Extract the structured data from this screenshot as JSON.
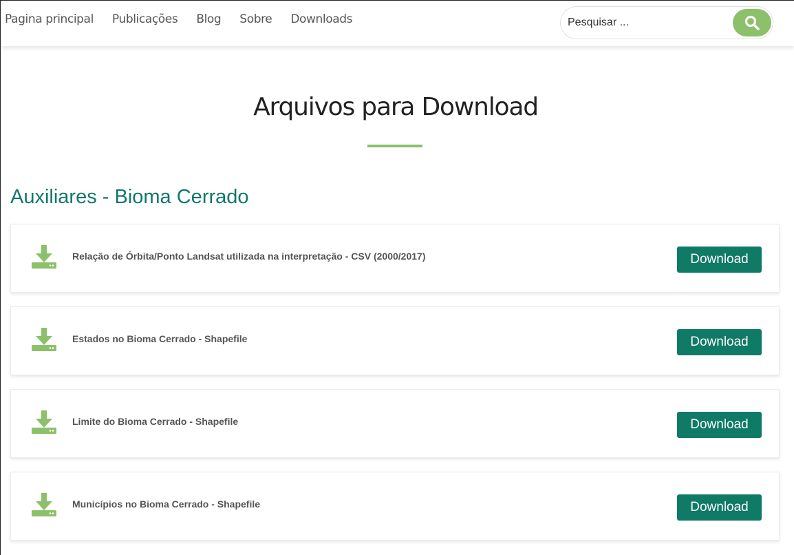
{
  "nav": {
    "items": [
      "Pagina principal",
      "Publicações",
      "Blog",
      "Sobre",
      "Downloads"
    ]
  },
  "search": {
    "placeholder": "Pesquisar ...",
    "icon": "search-icon"
  },
  "page": {
    "title": "Arquivos para Download",
    "section_title": "Auxiliares - Bioma Cerrado"
  },
  "downloads": [
    {
      "label": "Relação de Órbita/Ponto Landsat utilizada na interpretação - CSV (2000/2017)",
      "button": "Download",
      "icon": "download-icon"
    },
    {
      "label": "Estados no Bioma Cerrado - Shapefile",
      "button": "Download",
      "icon": "download-icon"
    },
    {
      "label": "Limite do Bioma Cerrado - Shapefile",
      "button": "Download",
      "icon": "download-icon"
    },
    {
      "label": "Municípios no Bioma Cerrado - Shapefile",
      "button": "Download",
      "icon": "download-icon"
    }
  ],
  "colors": {
    "accent_green": "#8cc06a",
    "button_teal": "#0f7a66",
    "section_teal": "#10786a",
    "text_gray": "#555555"
  }
}
